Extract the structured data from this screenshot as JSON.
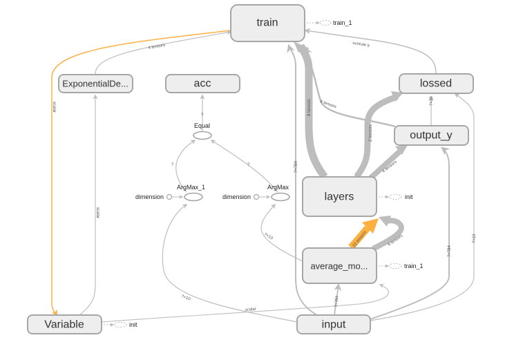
{
  "graph": {
    "colors": {
      "node_fill": "#eeeeee",
      "node_stroke": "#a6a6a6",
      "edge": "#bdbdbd",
      "highlight_edge": "#fbb040",
      "text": "#333333"
    },
    "nodes": {
      "train": "train",
      "exponential_decay": "ExponentialDe...",
      "acc": "acc",
      "lossed": "lossed",
      "output_y": "output_y",
      "equal": "Equal",
      "argmax_1": "ArgMax_1",
      "argmax": "ArgMax",
      "layers": "layers",
      "average_moving": "average_mo...",
      "variable": "Variable",
      "input": "input"
    },
    "constants": {
      "dimension_1": "dimension",
      "dimension_2": "dimension"
    },
    "aux_nodes": {
      "train_aux": "train_1",
      "layers_aux": "init",
      "average_aux": "train_1",
      "variable_aux": "init"
    },
    "edge_labels": {
      "exp_to_train": "4 tensors",
      "variable_to_train": "scalar",
      "variable_to_exp": "scalar",
      "lossed_to_train": "6 tensors",
      "outputy_to_train": "6 tensors",
      "layers_to_train": "8 tensors",
      "layers_to_lossed": "2 tensors",
      "layers_to_outputy": "4 tensors",
      "avg_to_layers_orange": "22 tensors",
      "avg_to_layers_gray": "8 tensors",
      "input_to_train": "?×784",
      "input_to_avg": "?×784",
      "input_to_outputy": "?×784",
      "input_to_lossed": "?×10",
      "outputy_to_lossed": "?×10",
      "input_to_argmax_1": "?×10",
      "avg_to_argmax": "?×10",
      "variable_to_avg": "scalar",
      "equal_to_acc": "?",
      "argmax1_to_equal": "?",
      "argmax_to_equal": "?"
    }
  }
}
